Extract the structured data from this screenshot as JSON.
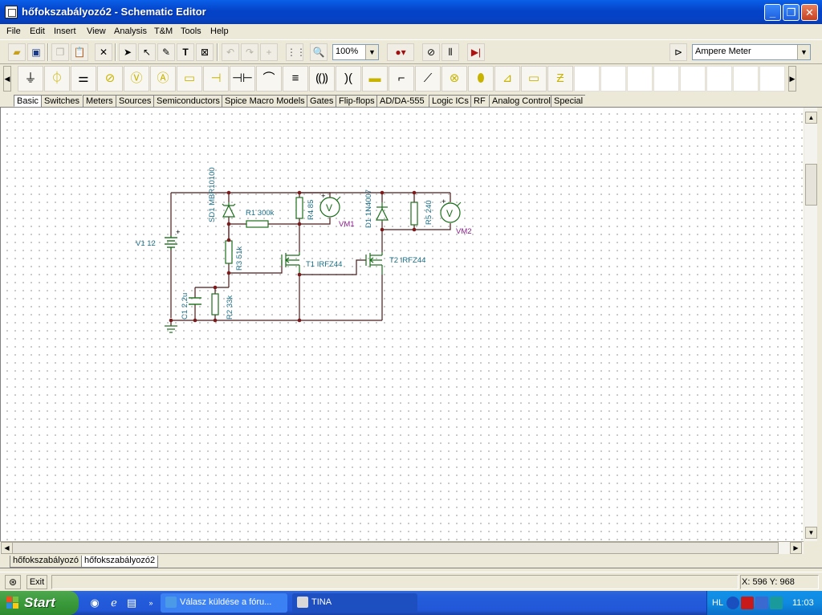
{
  "window": {
    "title": "hőfokszabályozó2 - Schematic Editor"
  },
  "menu": [
    "File",
    "Edit",
    "Insert",
    "View",
    "Analysis",
    "T&M",
    "Tools",
    "Help"
  ],
  "toolbar": {
    "zoom": "100%",
    "meter_select": "Ampere Meter"
  },
  "component_tabs": [
    "Basic",
    "Switches",
    "Meters",
    "Sources",
    "Semiconductors",
    "Spice Macro Models",
    "Gates",
    "Flip-flops",
    "AD/DA-555",
    "Logic ICs",
    "RF",
    "Analog Control",
    "Special"
  ],
  "schematic": {
    "labels": {
      "v1": "V1 12",
      "sd1": "SD1 MBR10100",
      "r1": "R1 300k",
      "r4": "R4 85",
      "vm1": "VM1",
      "vm1_symbol": "V",
      "d1": "D1 1N4007",
      "r5": "R5 240",
      "vm2": "VM2",
      "vm2_symbol": "V",
      "r3": "R3 51k",
      "t1": "T1 IRFZ44",
      "t2": "T2 IRFZ44",
      "c1": "C1 2,2u",
      "r2": "R2 33k",
      "plus": "+"
    }
  },
  "doc_tabs": [
    "hőfokszabályozó",
    "hőfokszabályozó2"
  ],
  "status": {
    "exit_label": "Exit",
    "coords": "X: 596  Y: 968"
  },
  "taskbar": {
    "start_label": "Start",
    "tasks": [
      "Válasz küldése a fóru...",
      "TINA"
    ],
    "tray_lang": "HL",
    "clock": "11:03"
  }
}
